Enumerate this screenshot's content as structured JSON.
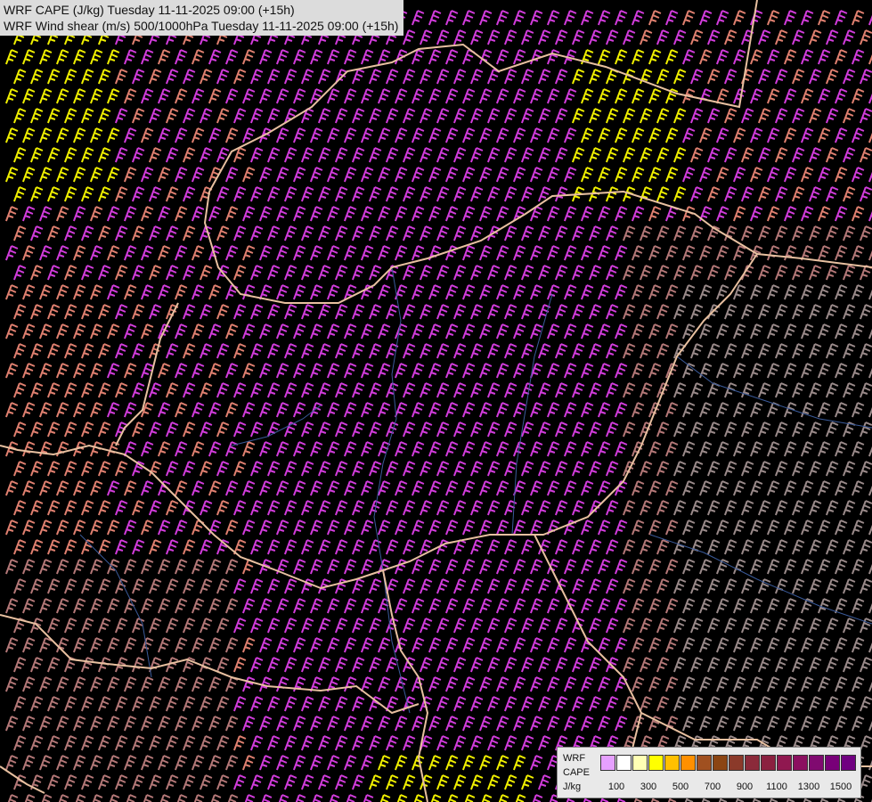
{
  "titles": {
    "line1": "WRF CAPE (J/kg) Tuesday 11-11-2025 09:00 (+15h)",
    "line2": "WRF Wind shear (m/s) 500/1000hPa Tuesday 11-11-2025 09:00 (+15h)"
  },
  "legend": {
    "line1": "WRF",
    "line2": "CAPE",
    "line3": "J/kg",
    "colors": [
      "#e6a0ff",
      "#ffffff",
      "#ffffb4",
      "#ffff00",
      "#ffc000",
      "#ff9000",
      "#a05020",
      "#8b4513",
      "#8b3a2a",
      "#8b2a3a",
      "#8b2040",
      "#901850",
      "#8b1060",
      "#800a70",
      "#780078",
      "#700080"
    ],
    "ticks": [
      "100",
      "300",
      "500",
      "700",
      "900",
      "1100",
      "1300",
      "1500"
    ]
  },
  "map": {
    "background": "#000000",
    "barb_colors": {
      "magenta": "#d23cdc",
      "salmon": "#e08070",
      "mauve": "#b47878",
      "yellow": "#f0f000",
      "gray": "#9a8a8a"
    },
    "border_color": "#e8c0a0",
    "river_color": "#3a5a9a"
  }
}
